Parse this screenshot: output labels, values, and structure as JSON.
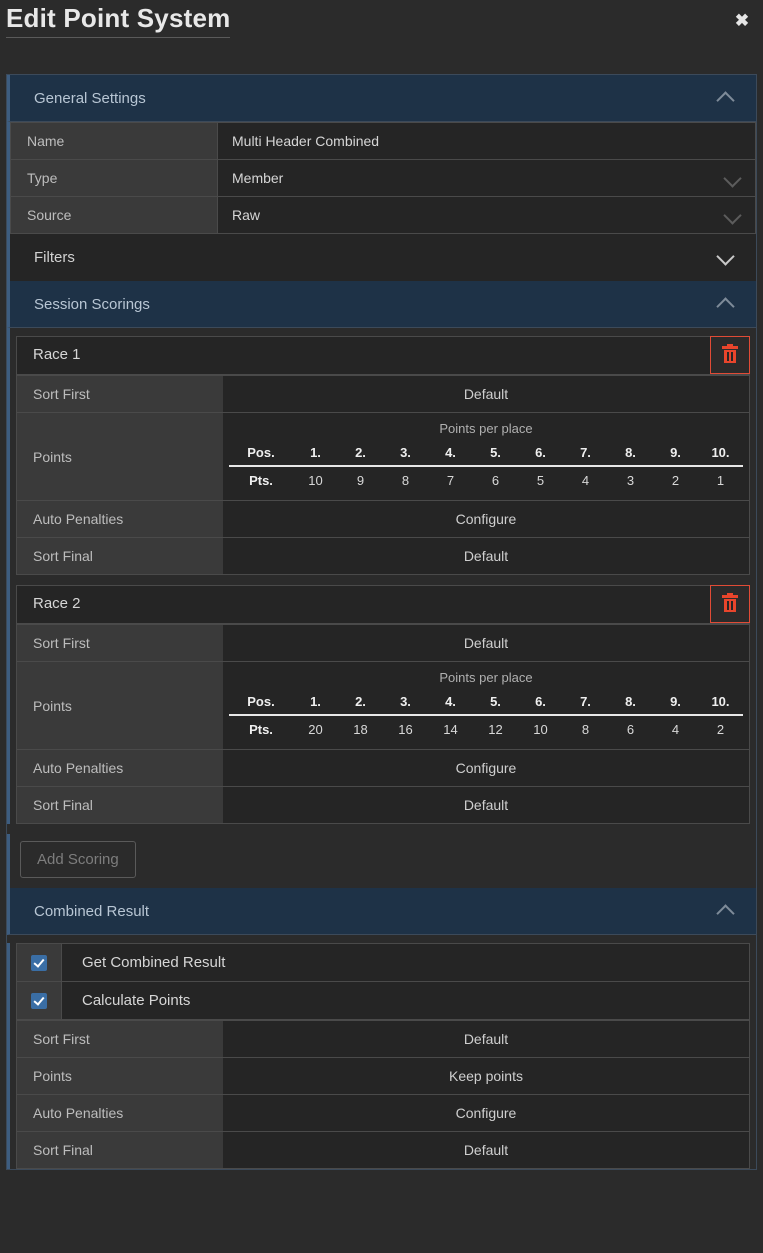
{
  "dialog": {
    "title": "Edit Point System",
    "close_label": "✖"
  },
  "general_settings": {
    "header": "General Settings",
    "rows": [
      {
        "label": "Name",
        "value": "Multi Header Combined",
        "control": "text"
      },
      {
        "label": "Type",
        "value": "Member",
        "control": "select"
      },
      {
        "label": "Source",
        "value": "Raw",
        "control": "select"
      }
    ]
  },
  "filters": {
    "header": "Filters"
  },
  "session_scorings": {
    "header": "Session Scorings",
    "points_table_title": "Points per place",
    "pos_row_label": "Pos.",
    "pts_row_label": "Pts.",
    "positions": [
      "1.",
      "2.",
      "3.",
      "4.",
      "5.",
      "6.",
      "7.",
      "8.",
      "9.",
      "10."
    ],
    "cards": [
      {
        "name": "Race 1",
        "delete_icon": "trash-icon",
        "sort_first_label": "Sort First",
        "sort_first_value": "Default",
        "points_label": "Points",
        "points": [
          10,
          9,
          8,
          7,
          6,
          5,
          4,
          3,
          2,
          1
        ],
        "auto_penalties_label": "Auto Penalties",
        "auto_penalties_value": "Configure",
        "sort_final_label": "Sort Final",
        "sort_final_value": "Default"
      },
      {
        "name": "Race 2",
        "delete_icon": "trash-icon",
        "sort_first_label": "Sort First",
        "sort_first_value": "Default",
        "points_label": "Points",
        "points": [
          20,
          18,
          16,
          14,
          12,
          10,
          8,
          6,
          4,
          2
        ],
        "auto_penalties_label": "Auto Penalties",
        "auto_penalties_value": "Configure",
        "sort_final_label": "Sort Final",
        "sort_final_value": "Default"
      }
    ],
    "add_scoring_label": "Add Scoring"
  },
  "combined_result": {
    "header": "Combined Result",
    "checkboxes": [
      {
        "label": "Get Combined Result",
        "checked": true
      },
      {
        "label": "Calculate Points",
        "checked": true
      }
    ],
    "rows": [
      {
        "label": "Sort First",
        "value": "Default"
      },
      {
        "label": "Points",
        "value": "Keep points"
      },
      {
        "label": "Auto Penalties",
        "value": "Configure"
      },
      {
        "label": "Sort Final",
        "value": "Default"
      }
    ]
  },
  "colors": {
    "background": "#2b2b2b",
    "section_header_open": "#1e3247",
    "accent_border": "#3d5d80",
    "checkbox": "#3a6ea5",
    "delete_red": "#e8452c",
    "label_cell": "#3a3a3a",
    "value_cell": "#252525"
  }
}
